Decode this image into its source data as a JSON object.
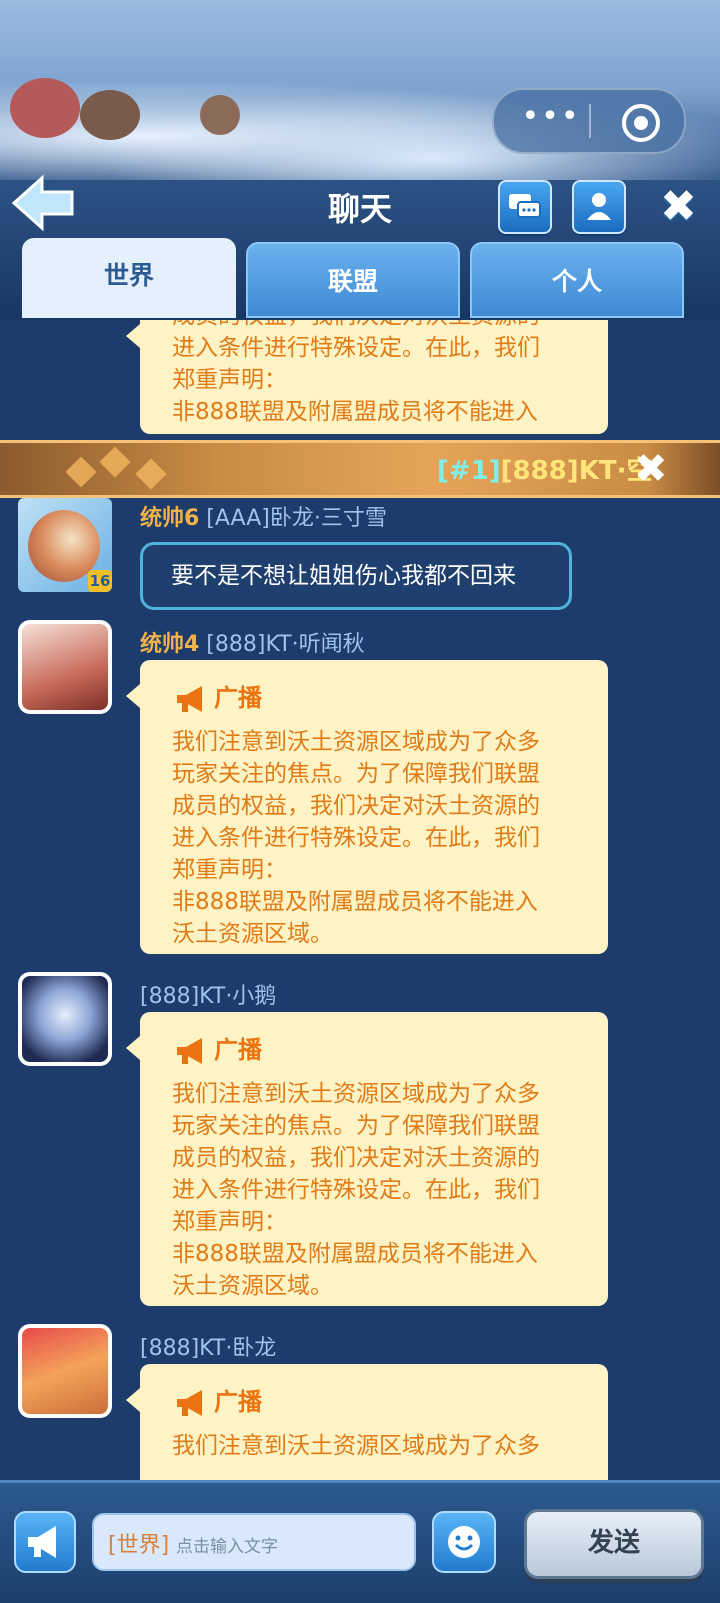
{
  "header": {
    "title": "聊天",
    "capsule": {
      "more_icon": "more-dots-icon",
      "close_icon": "record-circle-icon"
    },
    "back_icon": "back-arrow-icon",
    "chat_list_icon": "chat-bubbles-icon",
    "profile_icon": "user-icon",
    "close_icon": "close-x-icon"
  },
  "tabs": [
    {
      "label": "世界",
      "active": true
    },
    {
      "label": "联盟",
      "active": false
    },
    {
      "label": "个人",
      "active": false
    }
  ],
  "banner": {
    "tag": "[#1]",
    "text": "[888]KT·空",
    "close_icon": "close-x-icon"
  },
  "messages": [
    {
      "type": "broadcast-fragment",
      "lines": [
        "成员的权益，我们决定对沃土资源的",
        "进入条件进行特殊设定。在此，我们",
        "郑重声明：",
        "非888联盟及附属盟成员将不能进入"
      ]
    },
    {
      "type": "text",
      "rank": "统帅6",
      "sender": " [AAA]卧龙·三寸雪",
      "text": "要不是不想让姐姐伤心我都不回来",
      "level_badge": "16"
    },
    {
      "type": "broadcast",
      "rank": "统帅4",
      "sender": " [888]KT·听闻秋",
      "header": "广播",
      "lines": [
        "我们注意到沃土资源区域成为了众多",
        "玩家关注的焦点。为了保障我们联盟",
        "成员的权益，我们决定对沃土资源的",
        "进入条件进行特殊设定。在此，我们",
        "郑重声明：",
        "非888联盟及附属盟成员将不能进入",
        "沃土资源区域。"
      ]
    },
    {
      "type": "broadcast",
      "rank": "",
      "sender": "[888]KT·小鹅",
      "header": "广播",
      "lines": [
        "我们注意到沃土资源区域成为了众多",
        "玩家关注的焦点。为了保障我们联盟",
        "成员的权益，我们决定对沃土资源的",
        "进入条件进行特殊设定。在此，我们",
        "郑重声明：",
        "非888联盟及附属盟成员将不能进入",
        "沃土资源区域。"
      ]
    },
    {
      "type": "broadcast",
      "rank": "",
      "sender": "[888]KT·卧龙",
      "header": "广播",
      "lines": [
        "我们注意到沃土资源区域成为了众多"
      ]
    }
  ],
  "input": {
    "channel": "[世界]",
    "placeholder": "点击输入文字",
    "send_label": "发送",
    "horn_icon": "megaphone-icon",
    "emoji_icon": "smiley-icon"
  },
  "colors": {
    "background": "#1d3c6b",
    "bubble": "#fdf3c4",
    "broadcast_text": "#e07b18",
    "rank": "#f0b24a",
    "name": "#9ec2ea",
    "banner_text": "#ffe67a"
  }
}
